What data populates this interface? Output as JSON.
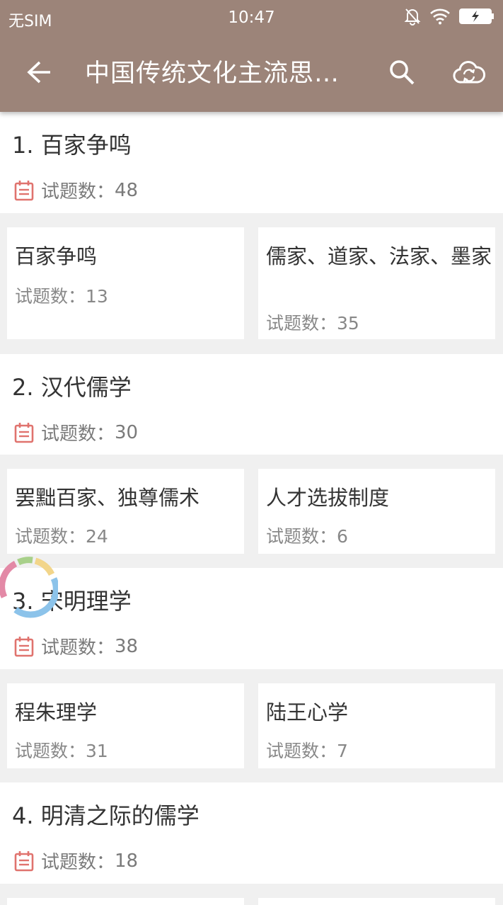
{
  "status_bar": {
    "carrier": "无SIM",
    "time": "10:47"
  },
  "toolbar": {
    "title": "中国传统文化主流思…"
  },
  "sections": [
    {
      "title": "1. 百家争鸣",
      "count_label": "试题数：",
      "count": "48",
      "cards": [
        {
          "title": "百家争鸣",
          "count_label": "试题数：",
          "count": "13"
        },
        {
          "title": "儒家、道家、法家、墨家",
          "count_label": "试题数：",
          "count": "35"
        }
      ]
    },
    {
      "title": "2. 汉代儒学",
      "count_label": "试题数：",
      "count": "30",
      "cards": [
        {
          "title": "罢黜百家、独尊儒术",
          "count_label": "试题数：",
          "count": "24"
        },
        {
          "title": "人才选拔制度",
          "count_label": "试题数：",
          "count": "6"
        }
      ]
    },
    {
      "title": "3. 宋明理学",
      "count_label": "试题数：",
      "count": "38",
      "cards": [
        {
          "title": "程朱理学",
          "count_label": "试题数：",
          "count": "31"
        },
        {
          "title": "陆王心学",
          "count_label": "试题数：",
          "count": "7"
        }
      ]
    },
    {
      "title": "4. 明清之际的儒学",
      "count_label": "试题数：",
      "count": "18"
    }
  ],
  "icons": {
    "back": "arrow-left-icon",
    "search": "search-icon",
    "cloud": "cloud-sync-icon",
    "calendar": "calendar-icon",
    "mute": "bell-off-icon",
    "wifi": "wifi-icon",
    "battery": "battery-charging-icon",
    "loading": "loading-spinner-icon"
  },
  "colors": {
    "toolbar": "#9c8479",
    "calendar_icon": "#e0736e",
    "background": "#f0f0f0"
  }
}
